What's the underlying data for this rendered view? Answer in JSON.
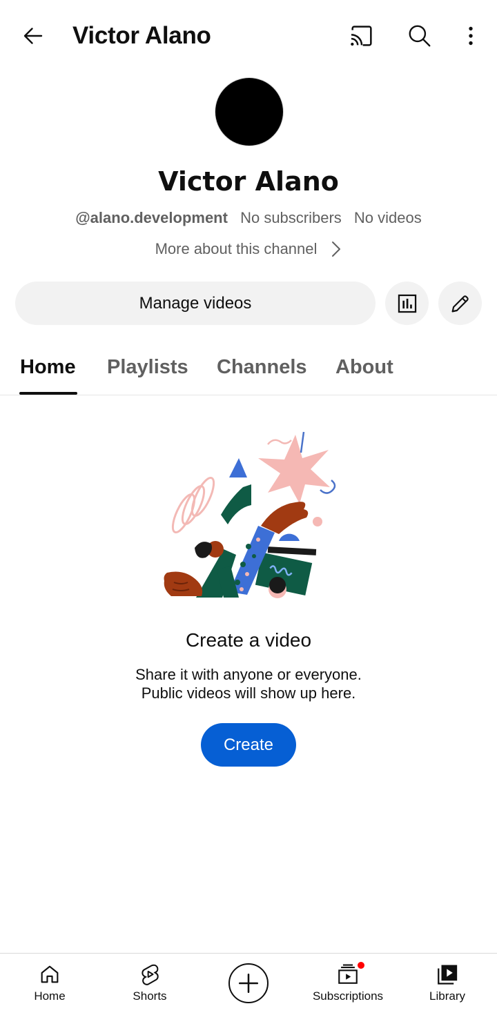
{
  "header": {
    "title": "Victor Alano"
  },
  "channel": {
    "name": "Victor Alano",
    "handle": "@alano.development",
    "subscribers": "No subscribers",
    "videos": "No videos",
    "more_about": "More about this channel"
  },
  "actions": {
    "manage_videos": "Manage videos"
  },
  "tabs": [
    {
      "label": "Home",
      "active": true
    },
    {
      "label": "Playlists",
      "active": false
    },
    {
      "label": "Channels",
      "active": false
    },
    {
      "label": "About",
      "active": false
    }
  ],
  "empty_state": {
    "title": "Create a video",
    "description_line1": "Share it with anyone or everyone.",
    "description_line2": "Public videos will show up here.",
    "button": "Create"
  },
  "bottom_nav": {
    "items": [
      {
        "label": "Home",
        "icon": "home-icon"
      },
      {
        "label": "Shorts",
        "icon": "shorts-icon"
      },
      {
        "label": "",
        "icon": "create-plus-icon"
      },
      {
        "label": "Subscriptions",
        "icon": "subscriptions-icon",
        "has_notification": true
      },
      {
        "label": "Library",
        "icon": "library-icon"
      }
    ]
  },
  "colors": {
    "accent": "#065fd4",
    "notification": "#ff0000",
    "secondary_text": "#606060",
    "button_bg": "#f2f2f2"
  }
}
